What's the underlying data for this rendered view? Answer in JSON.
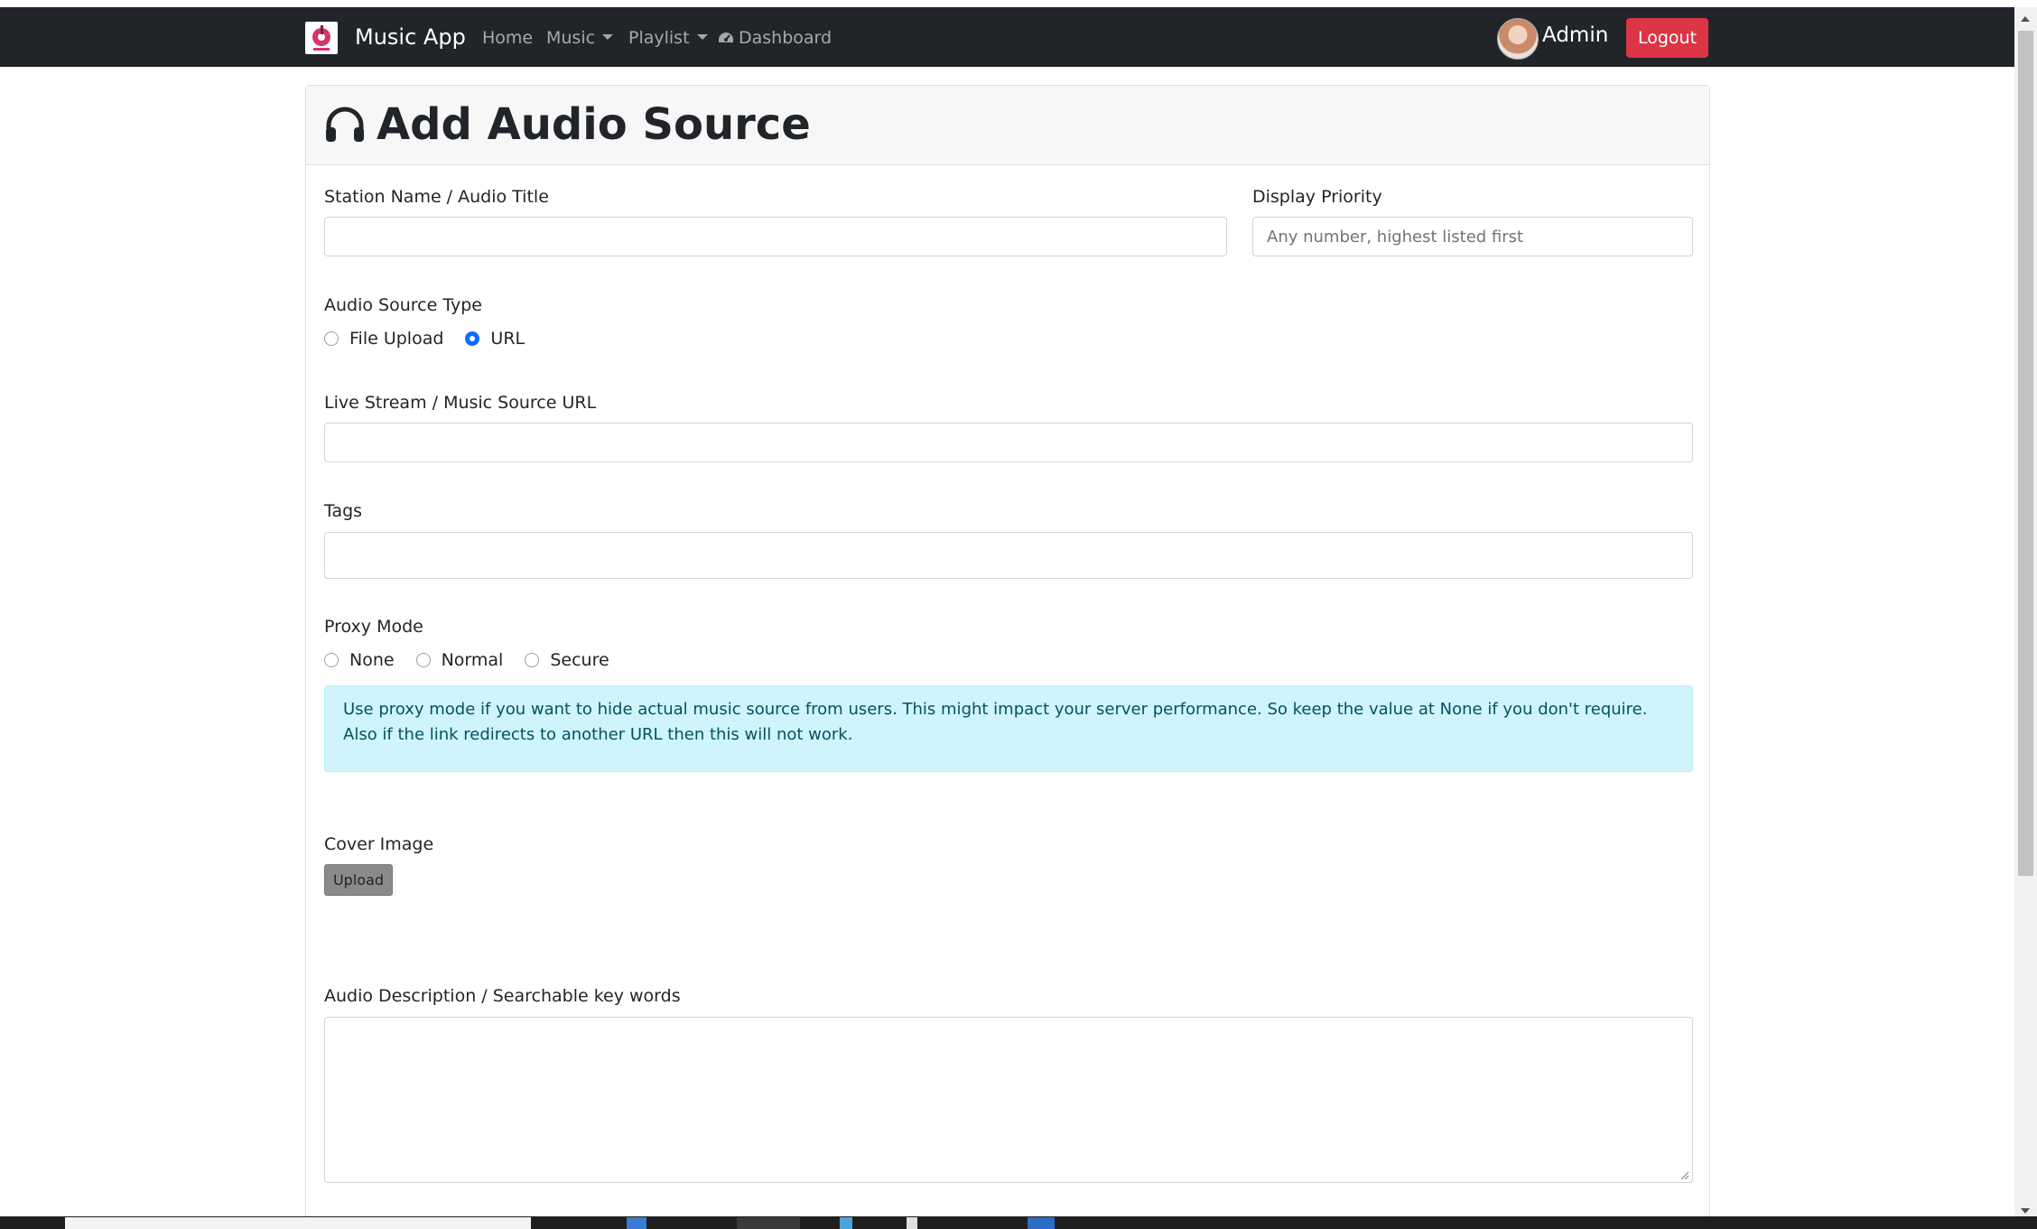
{
  "navbar": {
    "brand": "Music App",
    "items": [
      {
        "label": "Home",
        "dropdown": false
      },
      {
        "label": "Music",
        "dropdown": true
      },
      {
        "label": "Playlist",
        "dropdown": true
      },
      {
        "label": "Dashboard",
        "dropdown": false,
        "icon": "dashboard-icon"
      }
    ],
    "user_name": "Admin",
    "logout_label": "Logout"
  },
  "form": {
    "title": "Add Audio Source",
    "title_icon": "headphones-icon",
    "station_name_label": "Station Name / Audio Title",
    "station_name_value": "",
    "priority_label": "Display Priority",
    "priority_placeholder": "Any number, highest listed first",
    "source_type_label": "Audio Source Type",
    "source_type_options": [
      "File Upload",
      "URL"
    ],
    "source_type_selected": "URL",
    "url_label": "Live Stream / Music Source URL",
    "url_value": "",
    "tags_label": "Tags",
    "tags_value": "",
    "proxy_label": "Proxy Mode",
    "proxy_options": [
      "None",
      "Normal",
      "Secure"
    ],
    "proxy_selected": null,
    "proxy_alert": "Use proxy mode if you want to hide actual music source from users. This might impact your server performance. So keep the value at None if you don't require. Also if the link redirects to another URL then this will not work.",
    "cover_label": "Cover Image",
    "upload_label": "Upload",
    "description_label": "Audio Description / Searchable key words",
    "description_value": ""
  },
  "colors": {
    "navbar_bg": "#212529",
    "danger": "#dc3545",
    "radio_checked": "#0d6efd",
    "alert_bg": "#cff4fc",
    "alert_text": "#055160"
  }
}
